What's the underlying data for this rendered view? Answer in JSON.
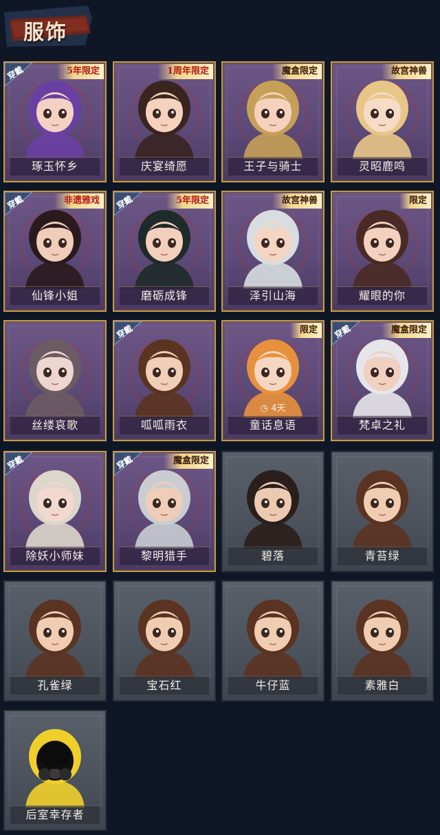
{
  "header": {
    "title": "服饰"
  },
  "items": [
    {
      "name": "琢玉怀乡",
      "wearing": true,
      "badge": "5年限定",
      "style": "purple",
      "skin": "#f3d2c4",
      "hair": "#6a3fa3"
    },
    {
      "name": "庆宴绮愿",
      "wearing": false,
      "badge": "1周年限定",
      "style": "purple",
      "skin": "#f4d2bd",
      "hair": "#3a2420"
    },
    {
      "name": "王子与骑士",
      "wearing": false,
      "badge": "魔盒限定",
      "style": "purple",
      "skin": "#f4d2bd",
      "hair": "#c7a058"
    },
    {
      "name": "灵昭鹿鸣",
      "wearing": false,
      "badge": "故宫神兽",
      "style": "purple",
      "skin": "#f6dcc7",
      "hair": "#e8c687"
    },
    {
      "name": "仙锋小姐",
      "wearing": true,
      "badge": "非遗雅戏",
      "style": "purple",
      "skin": "#f0cdb8",
      "hair": "#2b1a1d"
    },
    {
      "name": "磨砺成锋",
      "wearing": true,
      "badge": "5年限定",
      "style": "purple",
      "skin": "#f2d0bd",
      "hair": "#1f2a2a"
    },
    {
      "name": "泽引山海",
      "wearing": false,
      "badge": "故宫神兽",
      "style": "purple",
      "skin": "#f4d5c3",
      "hair": "#d7dde0"
    },
    {
      "name": "耀眼的你",
      "wearing": false,
      "badge": "限定",
      "style": "purple",
      "skin": "#f3d0bf",
      "hair": "#4a2a25"
    },
    {
      "name": "丝缕哀歌",
      "wearing": false,
      "badge": "",
      "style": "purple",
      "skin": "#eed6d0",
      "hair": "#6b5b63"
    },
    {
      "name": "呱呱雨衣",
      "wearing": true,
      "badge": "",
      "style": "purple",
      "skin": "#f1ceb6",
      "hair": "#5a3420"
    },
    {
      "name": "童话息语",
      "wearing": false,
      "badge": "限定",
      "style": "purple",
      "skin": "#f5d6c2",
      "hair": "#e8913c",
      "timer": "4天"
    },
    {
      "name": "梵卓之礼",
      "wearing": true,
      "badge": "魔盒限定",
      "style": "purple",
      "skin": "#efd0c1",
      "hair": "#e6e6ea"
    },
    {
      "name": "除妖小师妹",
      "wearing": true,
      "badge": "",
      "style": "purple",
      "skin": "#f1d9cf",
      "hair": "#dcd6cb"
    },
    {
      "name": "黎明猎手",
      "wearing": true,
      "badge": "魔盒限定",
      "style": "purple",
      "skin": "#efcdb8",
      "hair": "#c9cdd2"
    },
    {
      "name": "碧落",
      "wearing": false,
      "badge": "",
      "style": "gray",
      "skin": "#eccab2",
      "hair": "#2a1f1c"
    },
    {
      "name": "青苔绿",
      "wearing": false,
      "badge": "",
      "style": "gray",
      "skin": "#f0ccb3",
      "hair": "#5b3322"
    },
    {
      "name": "孔雀绿",
      "wearing": false,
      "badge": "",
      "style": "gray",
      "skin": "#f0ccb3",
      "hair": "#5b3322"
    },
    {
      "name": "宝石红",
      "wearing": false,
      "badge": "",
      "style": "gray",
      "skin": "#f0ccb3",
      "hair": "#5b3322"
    },
    {
      "name": "牛仔蓝",
      "wearing": false,
      "badge": "",
      "style": "gray",
      "skin": "#f0ccb3",
      "hair": "#5b3322"
    },
    {
      "name": "素雅白",
      "wearing": false,
      "badge": "",
      "style": "gray",
      "skin": "#f0ccb3",
      "hair": "#5b3322"
    },
    {
      "name": "后室幸存者",
      "wearing": false,
      "badge": "",
      "style": "gray",
      "skin": "#111111",
      "hair": "#f1cf2b"
    }
  ],
  "labels": {
    "wearing": "穿戴"
  },
  "colors": {
    "background": "#0f1726",
    "purpleBorder": "#c39a55",
    "grayBorder": "#2c3138",
    "banner": "#6b261b"
  }
}
